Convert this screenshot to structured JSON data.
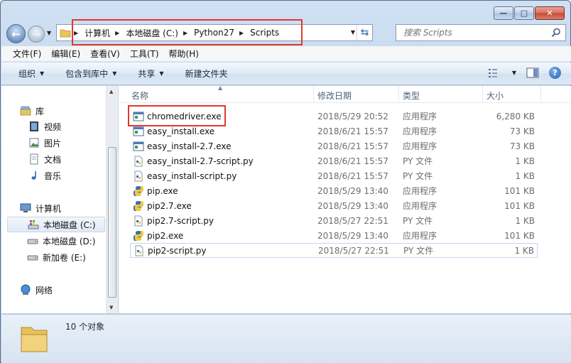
{
  "window": {
    "controls": {
      "minimize": "—",
      "maximize": "□",
      "close": "✕"
    }
  },
  "nav": {
    "back_icon": "back-arrow-icon",
    "forward_icon": "forward-arrow-icon",
    "breadcrumb": [
      "计算机",
      "本地磁盘 (C:)",
      "Python27",
      "Scripts"
    ],
    "search_placeholder": "搜索 Scripts"
  },
  "menu": [
    "文件(F)",
    "编辑(E)",
    "查看(V)",
    "工具(T)",
    "帮助(H)"
  ],
  "toolbar": {
    "organize": "组织",
    "include_in_library": "包含到库中",
    "share": "共享",
    "new_folder": "新建文件夹"
  },
  "sidebar": {
    "library": "库",
    "videos": "视频",
    "pictures": "图片",
    "documents": "文档",
    "music": "音乐",
    "computer": "计算机",
    "drive_c": "本地磁盘 (C:)",
    "drive_d": "本地磁盘 (D:)",
    "drive_e": "新加卷 (E:)",
    "network": "网络"
  },
  "columns": {
    "name": "名称",
    "date": "修改日期",
    "type": "类型",
    "size": "大小"
  },
  "files": [
    {
      "name": "chromedriver.exe",
      "date": "2018/5/29 20:52",
      "type": "应用程序",
      "size": "6,280 KB",
      "icon": "exe-window-icon"
    },
    {
      "name": "easy_install.exe",
      "date": "2018/6/21 15:57",
      "type": "应用程序",
      "size": "73 KB",
      "icon": "exe-window-icon"
    },
    {
      "name": "easy_install-2.7.exe",
      "date": "2018/6/21 15:57",
      "type": "应用程序",
      "size": "73 KB",
      "icon": "exe-window-icon"
    },
    {
      "name": "easy_install-2.7-script.py",
      "date": "2018/6/21 15:57",
      "type": "PY 文件",
      "size": "1 KB",
      "icon": "py-file-icon"
    },
    {
      "name": "easy_install-script.py",
      "date": "2018/6/21 15:57",
      "type": "PY 文件",
      "size": "1 KB",
      "icon": "py-file-icon"
    },
    {
      "name": "pip.exe",
      "date": "2018/5/29 13:40",
      "type": "应用程序",
      "size": "101 KB",
      "icon": "python-exe-icon"
    },
    {
      "name": "pip2.7.exe",
      "date": "2018/5/29 13:40",
      "type": "应用程序",
      "size": "101 KB",
      "icon": "python-exe-icon"
    },
    {
      "name": "pip2.7-script.py",
      "date": "2018/5/27 22:51",
      "type": "PY 文件",
      "size": "1 KB",
      "icon": "py-file-icon"
    },
    {
      "name": "pip2.exe",
      "date": "2018/5/29 13:40",
      "type": "应用程序",
      "size": "101 KB",
      "icon": "python-exe-icon"
    },
    {
      "name": "pip2-script.py",
      "date": "2018/5/27 22:51",
      "type": "PY 文件",
      "size": "1 KB",
      "icon": "py-file-icon"
    }
  ],
  "status": {
    "count": "10 个对象"
  },
  "colors": {
    "highlight": "#e2362f",
    "toolbar": "#dde8f4",
    "selection_border": "#c6d6ec"
  }
}
